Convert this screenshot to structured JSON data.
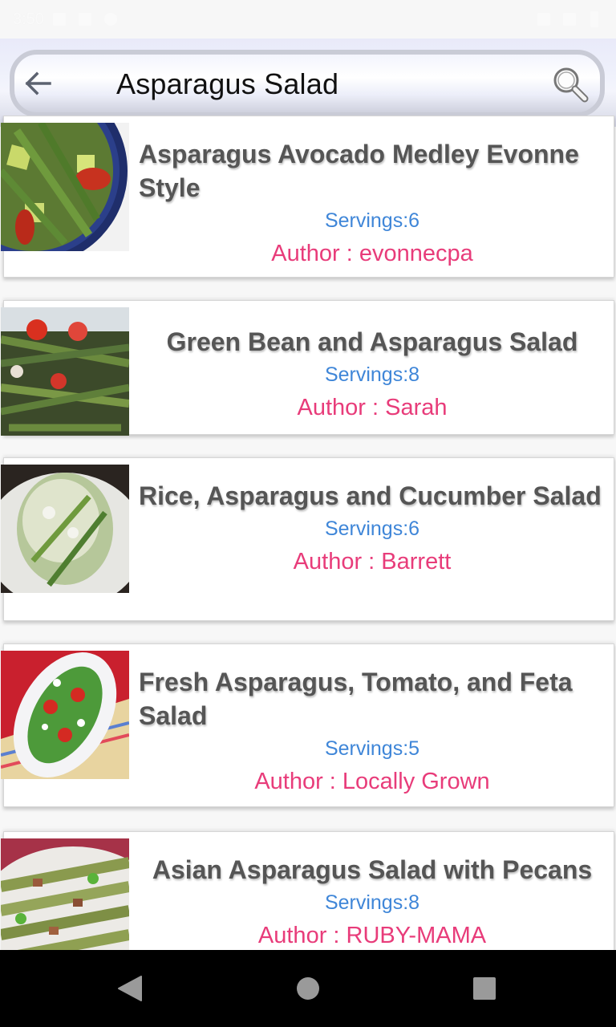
{
  "status_bar": {
    "time": "3:50"
  },
  "header": {
    "back_icon": "arrow-left-icon",
    "query": "Asparagus Salad",
    "search_icon": "magnifier-icon"
  },
  "recipes": [
    {
      "title": "Asparagus Avocado Medley Evonne Style",
      "servings": "Servings:6",
      "author": "Author : evonnecpa",
      "image": "asparagus-avocado-salad-photo"
    },
    {
      "title": "Green Bean and Asparagus Salad",
      "servings": "Servings:8",
      "author": "Author : Sarah",
      "image": "green-bean-asparagus-salad-photo"
    },
    {
      "title": "Rice, Asparagus and Cucumber Salad",
      "servings": "Servings:6",
      "author": "Author : Barrett",
      "image": "rice-asparagus-cucumber-salad-photo"
    },
    {
      "title": "Fresh Asparagus, Tomato, and Feta Salad",
      "servings": "Servings:5",
      "author": "Author : Locally Grown",
      "image": "asparagus-tomato-feta-salad-photo"
    },
    {
      "title": "Asian Asparagus Salad with Pecans",
      "servings": "Servings:8",
      "author": "Author : RUBY-MAMA",
      "image": "asian-asparagus-pecan-salad-photo"
    }
  ],
  "colors": {
    "title": "#555555",
    "servings": "#3f86d8",
    "author": "#e83c7a",
    "nav_bar": "#000000"
  },
  "nav_bar": {
    "back": "nav-back-icon",
    "home": "nav-home-icon",
    "recents": "nav-recents-icon"
  }
}
